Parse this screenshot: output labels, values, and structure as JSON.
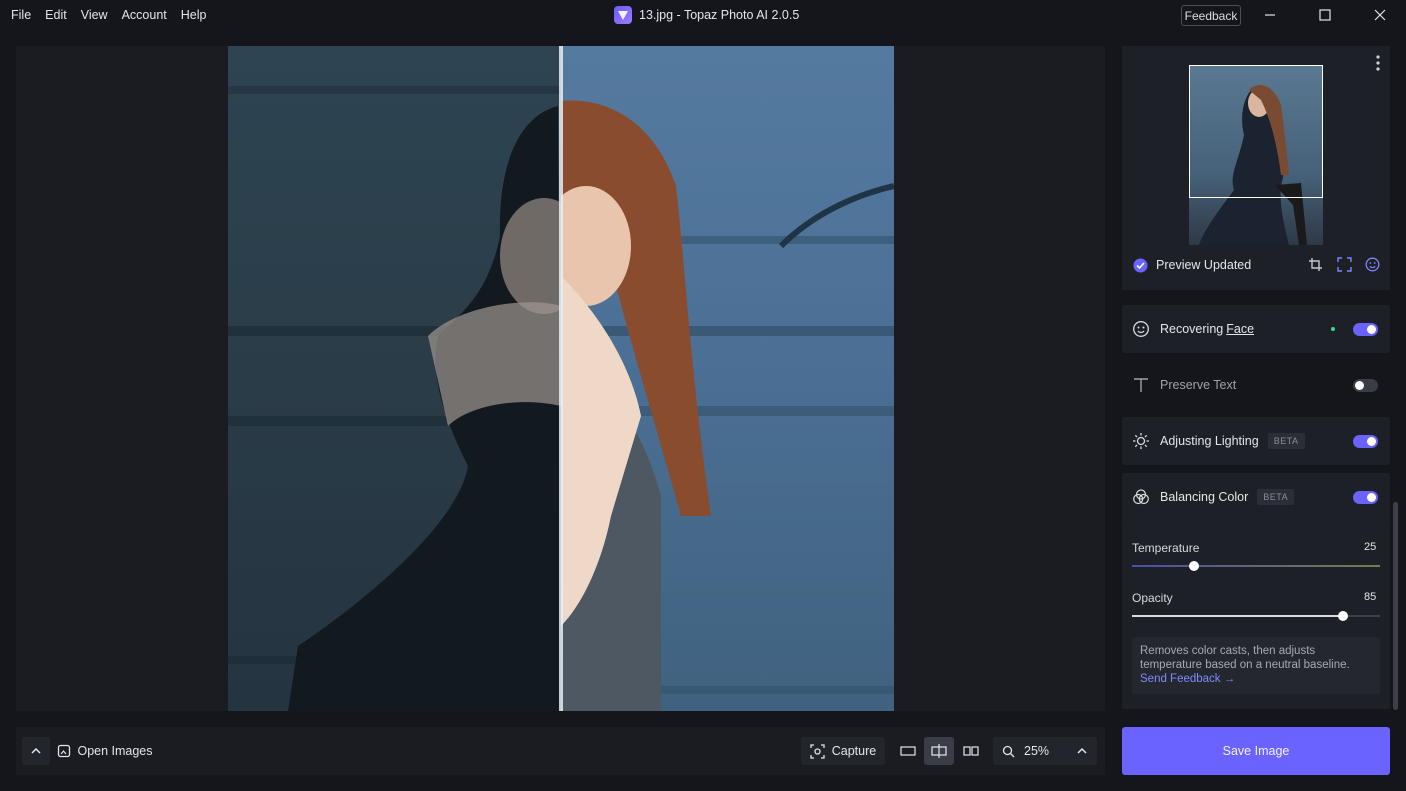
{
  "menu": [
    "File",
    "Edit",
    "View",
    "Account",
    "Help"
  ],
  "window": {
    "title": "13.jpg - Topaz Photo AI 2.0.5",
    "feedback_label": "Feedback",
    "minimize_icon": "minimize-icon",
    "maximize_icon": "maximize-icon",
    "close_icon": "close-icon"
  },
  "preview": {
    "status": "Preview Updated",
    "icons": [
      "crop-icon",
      "fullscreen-icon",
      "face-icon"
    ],
    "more_icon": "more-vertical-icon"
  },
  "cards": {
    "face": {
      "label_prefix": "Recovering ",
      "label_link": "Face",
      "enabled": true,
      "icon": "face-icon"
    },
    "text": {
      "label": "Preserve Text",
      "enabled": false,
      "icon": "text-icon"
    },
    "lighting": {
      "label": "Adjusting Lighting",
      "badge": "BETA",
      "enabled": true,
      "icon": "sun-icon"
    },
    "color": {
      "label": "Balancing Color",
      "badge": "BETA",
      "enabled": true,
      "icon": "color-balance-icon"
    }
  },
  "color_sliders": {
    "temperature": {
      "label": "Temperature",
      "value": "25",
      "level": 0.25
    },
    "opacity": {
      "label": "Opacity",
      "value": "85",
      "level": 0.85
    }
  },
  "info": {
    "text": "Removes color casts, then adjusts temperature based on a neutral baseline.",
    "link": "Send Feedback →"
  },
  "bottombar": {
    "open_images": "Open Images",
    "capture": "Capture",
    "zoom": "25%",
    "view_modes": [
      "single-view-icon",
      "split-view-icon",
      "side-by-side-icon"
    ],
    "active_view": "split-view-icon"
  },
  "save_label": "Save Image",
  "colors": {
    "accent": "#6a63ff",
    "link": "#7b8cff",
    "status_dot": "#3ddc84"
  }
}
